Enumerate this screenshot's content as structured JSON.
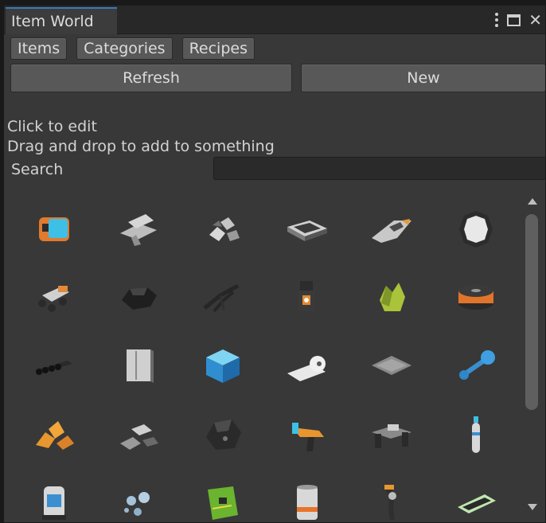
{
  "window": {
    "tab_title": "Item World"
  },
  "toolbar": {
    "toggles": [
      "Items",
      "Categories",
      "Recipes"
    ],
    "refresh_label": "Refresh",
    "new_label": "New"
  },
  "help": {
    "line1": "Click to edit",
    "line2": "Drag and drop to add to something"
  },
  "search": {
    "label": "Search",
    "value": ""
  },
  "items": [
    "scanner-device",
    "metal-plate-stack",
    "scrap-pile",
    "metal-tray",
    "spaceship",
    "round-mirror",
    "rover-vehicle",
    "rock-lump",
    "folding-frame",
    "lantern-device",
    "green-crystal",
    "copper-spool",
    "pipe-bundle",
    "metal-panel",
    "blue-cube",
    "fabric-roll",
    "mesh-plate",
    "blue-dumbbell",
    "orange-ore",
    "grey-stones",
    "dark-meteorite",
    "blaster-tool",
    "workbench",
    "gas-cylinder",
    "backpack",
    "bubbles",
    "circuit-board",
    "canister",
    "robot-arm",
    "glass-shard"
  ]
}
